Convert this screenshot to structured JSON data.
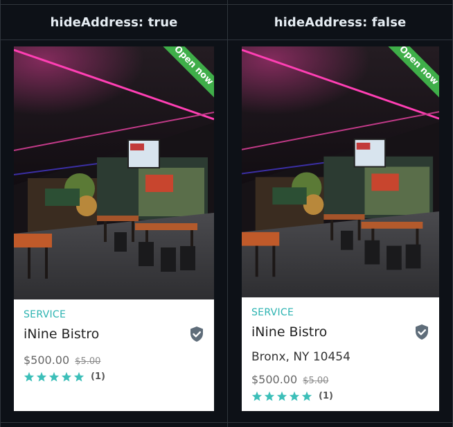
{
  "columns": [
    {
      "header": "hideAddress: true",
      "card": {
        "badge": "Open now",
        "category": "SERVICE",
        "title": "iNine Bistro",
        "address": "",
        "price": "$500.00",
        "old_price": "$5.00",
        "rating": 5,
        "rating_count": "(1)"
      }
    },
    {
      "header": "hideAddress: false",
      "card": {
        "badge": "Open now",
        "category": "SERVICE",
        "title": "iNine Bistro",
        "address": "Bronx, NY 10454",
        "price": "$500.00",
        "old_price": "$5.00",
        "rating": 5,
        "rating_count": "(1)"
      }
    }
  ],
  "colors": {
    "background": "#0d1117",
    "border": "#30363d",
    "accent_teal": "#2bb3b1",
    "badge_green": "#3fae49",
    "star": "#3dbfb9",
    "shield": "#5f6d7a"
  },
  "icons": {
    "verified": "shield-check-icon",
    "star": "star-icon"
  }
}
